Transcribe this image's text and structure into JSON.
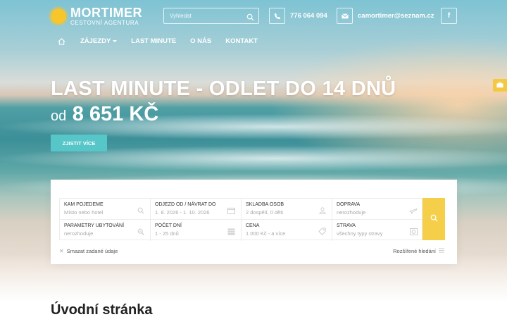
{
  "brand": {
    "name": "MORTIMER",
    "subtitle": "CESTOVNÍ AGENTURA"
  },
  "header": {
    "search_placeholder": "Vyhledat",
    "phone": "776 064 094",
    "email": "camortimer@seznam.cz",
    "facebook": "f"
  },
  "nav": {
    "items": [
      {
        "label": "ZÁJEZDY",
        "has_dropdown": true
      },
      {
        "label": "LAST MINUTE"
      },
      {
        "label": "O NÁS"
      },
      {
        "label": "KONTAKT"
      }
    ]
  },
  "hero": {
    "title": "LAST MINUTE - ODLET DO 14 DNŮ",
    "price_prefix": "od",
    "price": "8 651 KČ",
    "cta": "ZJISTIT VÍCE"
  },
  "search_form": {
    "fields": [
      {
        "label": "KAM POJEDEME",
        "value": "Místo nebo hotel",
        "icon": "search-icon"
      },
      {
        "label": "ODJEZD OD / NÁVRAT DO",
        "value": "1. 8. 2026 - 1. 10. 2026",
        "icon": "calendar-icon"
      },
      {
        "label": "SKLADBA OSOB",
        "value": "2 dospělí, 0 děti",
        "icon": "person-icon"
      },
      {
        "label": "DOPRAVA",
        "value": "nerozhoduje",
        "icon": "plane-icon"
      },
      {
        "label": "PARAMETRY UBYTOVÁNÍ",
        "value": "nerozhoduje",
        "icon": "zoom-icon"
      },
      {
        "label": "POČET DNÍ",
        "value": "1 - 25 dnů",
        "icon": "calendar-grid-icon"
      },
      {
        "label": "CENA",
        "value": "1 000 Kč - a více",
        "icon": "tag-icon"
      },
      {
        "label": "STRAVA",
        "value": "všechny typy stravy",
        "icon": "food-icon"
      }
    ],
    "clear_label": "Smazat zadané údaje",
    "advanced_label": "Rozšířené hledání"
  },
  "main": {
    "section_title": "Úvodní stránka"
  },
  "colors": {
    "accent_teal": "#57c6c9",
    "accent_yellow": "#f5ce4a"
  }
}
